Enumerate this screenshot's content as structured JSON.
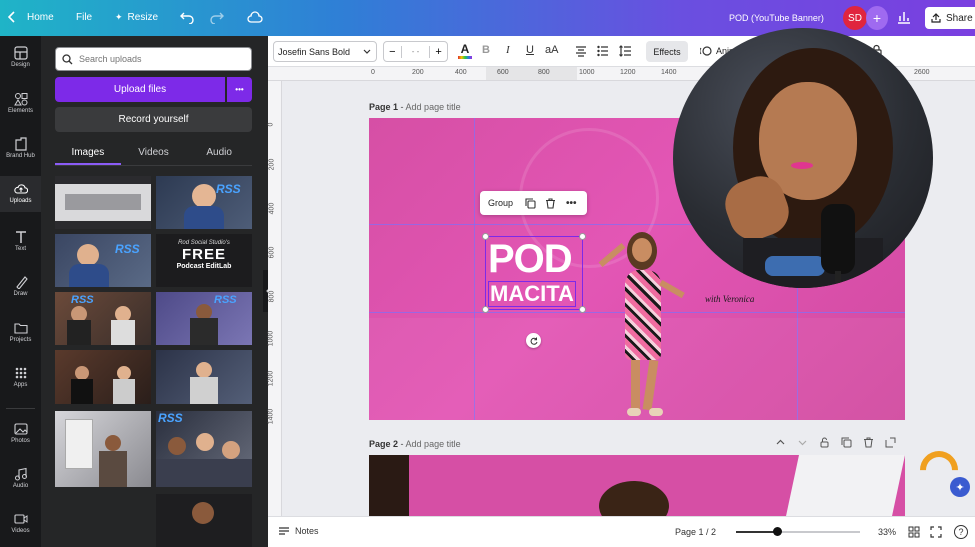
{
  "topbar": {
    "home": "Home",
    "file": "File",
    "resize": "Resize",
    "doc_title": "POD (YouTube Banner)",
    "avatar": "SD",
    "share": "Share"
  },
  "rail": [
    {
      "label": "Design",
      "icon": "design-icon"
    },
    {
      "label": "Elements",
      "icon": "elements-icon"
    },
    {
      "label": "Brand Hub",
      "icon": "brand-hub-icon"
    },
    {
      "label": "Uploads",
      "icon": "cloud-upload-icon"
    },
    {
      "label": "Text",
      "icon": "text-icon"
    },
    {
      "label": "Draw",
      "icon": "draw-icon"
    },
    {
      "label": "Projects",
      "icon": "folder-icon"
    },
    {
      "label": "Apps",
      "icon": "apps-icon"
    },
    {
      "label": "Photos",
      "icon": "photos-icon"
    },
    {
      "label": "Audio",
      "icon": "audio-icon"
    },
    {
      "label": "Videos",
      "icon": "videos-icon"
    }
  ],
  "panel": {
    "search_placeholder": "Search uploads",
    "upload_files": "Upload files",
    "more": "•••",
    "record": "Record yourself",
    "tabs": [
      "Images",
      "Videos",
      "Audio"
    ],
    "thumb_text": {
      "free_line1": "FREE",
      "free_line2": "Podcast EditLab",
      "script": "Rod Social Studio's"
    }
  },
  "toolbar": {
    "font": "Josefin Sans Bold",
    "minus": "−",
    "size": "- -",
    "plus": "+",
    "text_color_letter": "A",
    "bold": "B",
    "italic": "I",
    "underline": "U",
    "case": "aA",
    "effects": "Effects",
    "animate": "Animate",
    "colors": {
      "accent": "#7d2ae8",
      "text_underline": "#7d2ae8"
    }
  },
  "ruler_h": [
    "0",
    "200",
    "400",
    "600",
    "800",
    "1000",
    "1200",
    "1400",
    "2600"
  ],
  "ruler_v": [
    "0",
    "200",
    "400",
    "600",
    "800",
    "1000",
    "1200",
    "1400"
  ],
  "page1": {
    "label": "Page 1",
    "title_placeholder": "Add page title",
    "group_label": "Group",
    "pod": "POD",
    "macita": "MACITA",
    "with": "with Veronica"
  },
  "page2": {
    "label": "Page 2",
    "title_placeholder": "Add page title"
  },
  "bottombar": {
    "notes": "Notes",
    "page_indicator": "Page 1 / 2",
    "zoom": "33%",
    "zoom_level": 0.33
  }
}
